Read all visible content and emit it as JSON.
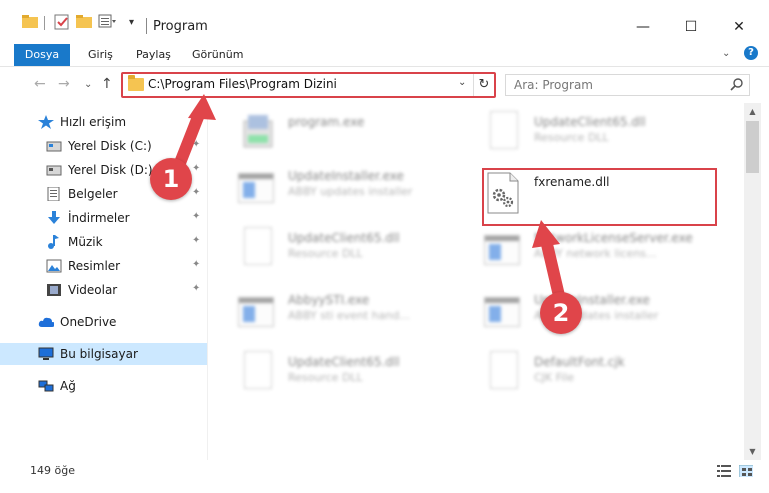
{
  "window": {
    "title": "Program",
    "minimize_glyph": "—",
    "maximize_glyph": "☐",
    "close_glyph": "✕"
  },
  "ribbon": {
    "tabs": [
      {
        "label": "Dosya",
        "active": true
      },
      {
        "label": "Giriş"
      },
      {
        "label": "Paylaş"
      },
      {
        "label": "Görünüm"
      }
    ],
    "expand_glyph": "⌄",
    "help_glyph": "?"
  },
  "nav": {
    "back_glyph": "←",
    "forward_glyph": "→",
    "recent_glyph": "⌄",
    "up_glyph": "↑",
    "address": "C:\\Program Files\\Program Dizini",
    "address_dropdown_glyph": "⌄",
    "refresh_glyph": "↻",
    "search_placeholder": "Ara: Program"
  },
  "sidebar": {
    "pin_glyph": "✦",
    "items": [
      {
        "label": "Hızlı erişim",
        "icon": "star-icon"
      },
      {
        "label": "Yerel Disk (C:)",
        "icon": "drive-icon",
        "pinned": true
      },
      {
        "label": "Yerel Disk (D:)",
        "icon": "drive-icon",
        "pinned": true
      },
      {
        "label": "Belgeler",
        "icon": "documents-icon",
        "pinned": true
      },
      {
        "label": "İndirmeler",
        "icon": "download-icon",
        "pinned": true
      },
      {
        "label": "Müzik",
        "icon": "music-icon",
        "pinned": true
      },
      {
        "label": "Resimler",
        "icon": "pictures-icon",
        "pinned": true
      },
      {
        "label": "Videolar",
        "icon": "videos-icon",
        "pinned": true
      },
      {
        "label": "OneDrive",
        "icon": "cloud-icon"
      },
      {
        "label": "Bu bilgisayar",
        "icon": "computer-icon",
        "selected": true
      },
      {
        "label": "Ağ",
        "icon": "network-icon"
      }
    ]
  },
  "files": [
    {
      "name": "program.exe",
      "type": "",
      "icon": "installer-icon"
    },
    {
      "name": "UpdateClient65.dll",
      "type": "Resource DLL",
      "icon": "document-icon"
    },
    {
      "name": "UpdateInstaller.exe",
      "type": "ABBY updates installer",
      "icon": "window-icon"
    },
    {
      "name": "fxrename.dll",
      "type": "",
      "icon": "dll-gear-icon"
    },
    {
      "name": "UpdateClient65.dll",
      "type": "Resource DLL",
      "icon": "document-icon"
    },
    {
      "name": "NetworkLicenseServer.exe",
      "type": "ABBY network licens...",
      "icon": "window-icon"
    },
    {
      "name": "AbbyySTI.exe",
      "type": "ABBY sti event hand...",
      "icon": "window-icon"
    },
    {
      "name": "UpdateInstaller.exe",
      "type": "ABBY updates installer",
      "icon": "window-icon"
    },
    {
      "name": "UpdateClient65.dll",
      "type": "Resource DLL",
      "icon": "document-icon"
    },
    {
      "name": "DefaultFont.cjk",
      "type": "CJK File",
      "icon": "document-icon"
    }
  ],
  "status": {
    "item_count": "149 öğe"
  },
  "annotations": {
    "marker_1": "1",
    "marker_2": "2",
    "color": "#e0454a"
  },
  "colors": {
    "accent": "#1979ca",
    "selection": "#cce8ff",
    "highlight": "#d9434a"
  }
}
